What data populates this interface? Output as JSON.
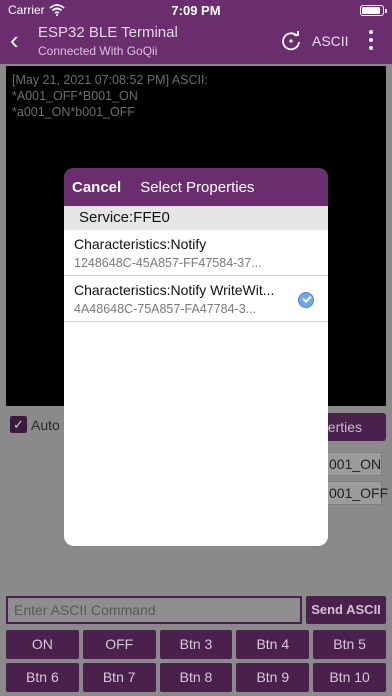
{
  "status_bar": {
    "carrier": "Carrier",
    "time": "7:09 PM"
  },
  "nav": {
    "title": "ESP32 BLE Terminal",
    "subtitle": "Connected With GoQii",
    "ascii_label": "ASCII"
  },
  "terminal": {
    "lines": [
      "[May 21, 2021 07:08:52 PM] ASCII:",
      "*A001_OFF*B001_ON",
      "*a001_ON*b001_OFF"
    ]
  },
  "controls": {
    "auto_label": "Auto",
    "properties_label": "perties",
    "cmd_one": "001_ON",
    "cmd_two": "001_OFF"
  },
  "input": {
    "placeholder": "Enter ASCII Command",
    "send_label": "Send ASCII"
  },
  "buttons": [
    "ON",
    "OFF",
    "Btn 3",
    "Btn 4",
    "Btn 5",
    "Btn 6",
    "Btn 7",
    "Btn 8",
    "Btn 9",
    "Btn 10"
  ],
  "modal": {
    "cancel_label": "Cancel",
    "title": "Select Properties",
    "service": "Service:FFE0",
    "characteristics": [
      {
        "name": "Characteristics:Notify",
        "uuid": "1248648C-45A857-FF47584-37...",
        "selected": false
      },
      {
        "name": "Characteristics:Notify WriteWit...",
        "uuid": "4A48648C-75A857-FA47784-3...",
        "selected": true
      }
    ]
  },
  "colors": {
    "brand_purple": "#6a2d6e",
    "dimmed_purple": "#4a214d",
    "check_blue": "#6fa8e8"
  }
}
